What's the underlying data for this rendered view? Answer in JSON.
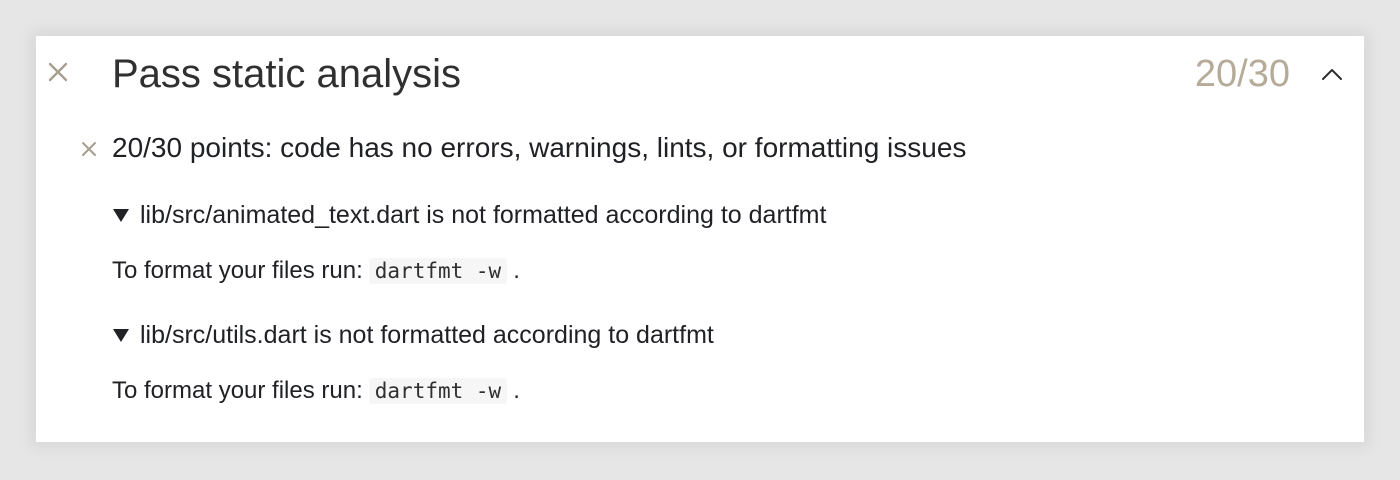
{
  "section": {
    "title": "Pass static analysis",
    "score": "20/30",
    "status_icon": "x-icon",
    "toggle_icon": "chevron-up-icon"
  },
  "summary": {
    "icon": "x-icon",
    "text": "20/30 points: code has no errors, warnings, lints, or formatting issues"
  },
  "issues": [
    {
      "title": "lib/src/animated_text.dart is not formatted according to dartfmt",
      "body_prefix": "To format your files run:",
      "command": "dartfmt -w",
      "body_suffix": "."
    },
    {
      "title": "lib/src/utils.dart is not formatted according to dartfmt",
      "body_prefix": "To format your files run:",
      "command": "dartfmt -w",
      "body_suffix": "."
    }
  ],
  "colors": {
    "score": "#b5ab98",
    "icon": "#a99f8f"
  }
}
